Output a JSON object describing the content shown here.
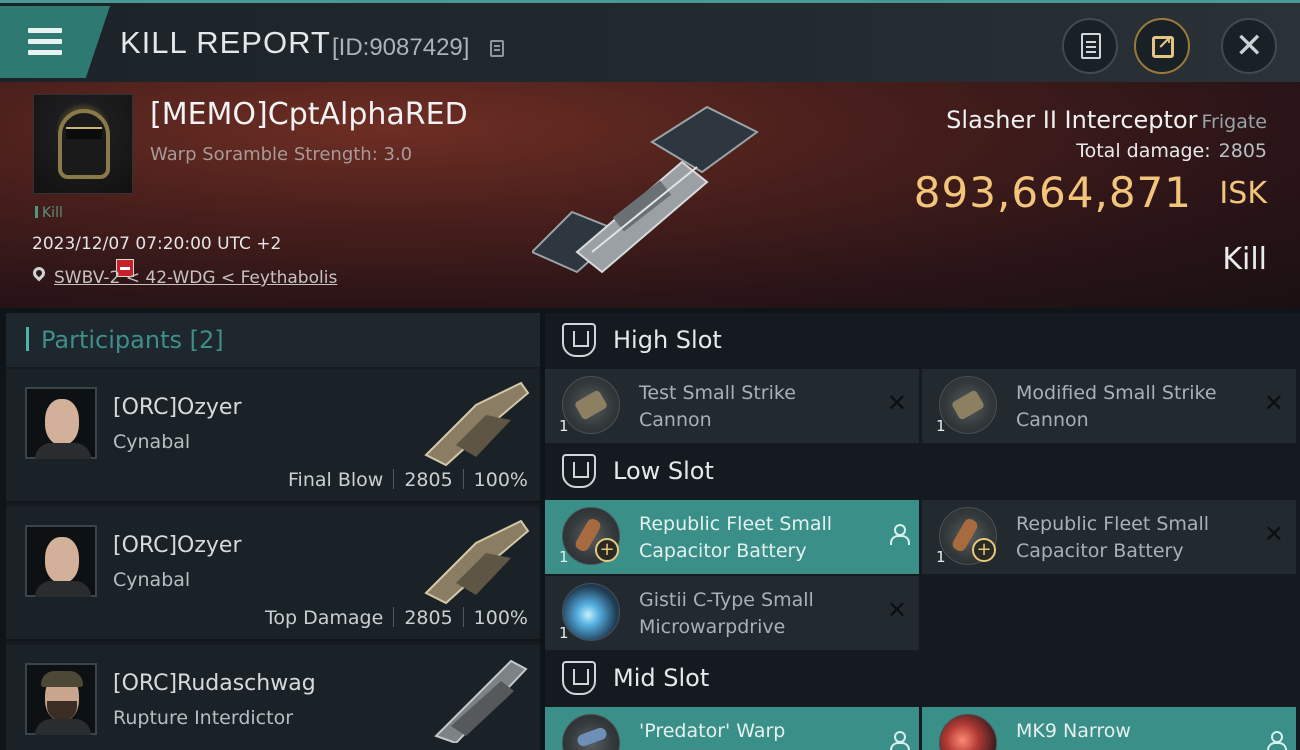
{
  "header": {
    "title": "KILL REPORT",
    "report_id": "[ID:9087429]",
    "icons": {
      "menu": "hamburger-icon",
      "copy": "copy-icon",
      "clipboard": "clipboard-icon",
      "share": "share-icon",
      "close": "close-icon"
    }
  },
  "victim": {
    "name": "[MEMO]CptAlphaRED",
    "scramble": "Warp Soramble Strength: 3.0",
    "tag": "Kill",
    "datetime": "2023/12/07 07:20:00 UTC +2",
    "location": "SWBV-2 < 42-WDG < Feythabolis",
    "ship_name": "Slasher II Interceptor",
    "ship_class": "Frigate",
    "total_damage_label": "Total damage:",
    "total_damage": "2805",
    "isk_value": "893,664,871",
    "isk_unit": "ISK",
    "result": "Kill"
  },
  "participants": {
    "title": "Participants [2]",
    "rows": [
      {
        "name": "[ORC]Ozyer",
        "ship": "Cynabal",
        "role": "Final Blow",
        "damage": "2805",
        "percent": "100%"
      },
      {
        "name": "[ORC]Ozyer",
        "ship": "Cynabal",
        "role": "Top Damage",
        "damage": "2805",
        "percent": "100%"
      },
      {
        "name": "[ORC]Rudaschwag",
        "ship": "Rupture Interdictor"
      }
    ]
  },
  "slots": {
    "high": {
      "title": "High Slot",
      "modules": [
        {
          "qty": "1",
          "name1": "Test Small Strike",
          "name2": "Cannon"
        },
        {
          "qty": "1",
          "name1": "Modified Small Strike",
          "name2": "Cannon"
        }
      ]
    },
    "low": {
      "title": "Low Slot",
      "modules": [
        {
          "qty": "1",
          "name1": "Republic Fleet Small",
          "name2": "Capacitor Battery"
        },
        {
          "qty": "1",
          "name1": "Republic Fleet Small",
          "name2": "Capacitor Battery"
        },
        {
          "qty": "1",
          "name1": "Gistii C-Type Small",
          "name2": "Microwarpdrive"
        }
      ]
    },
    "mid": {
      "title": "Mid Slot",
      "modules": [
        {
          "name1": "'Predator' Warp"
        },
        {
          "name1": "MK9 Narrow"
        }
      ]
    }
  },
  "colors": {
    "accent": "#3b8f89",
    "isk": "#f2c57a",
    "badge": "#c8202a"
  }
}
